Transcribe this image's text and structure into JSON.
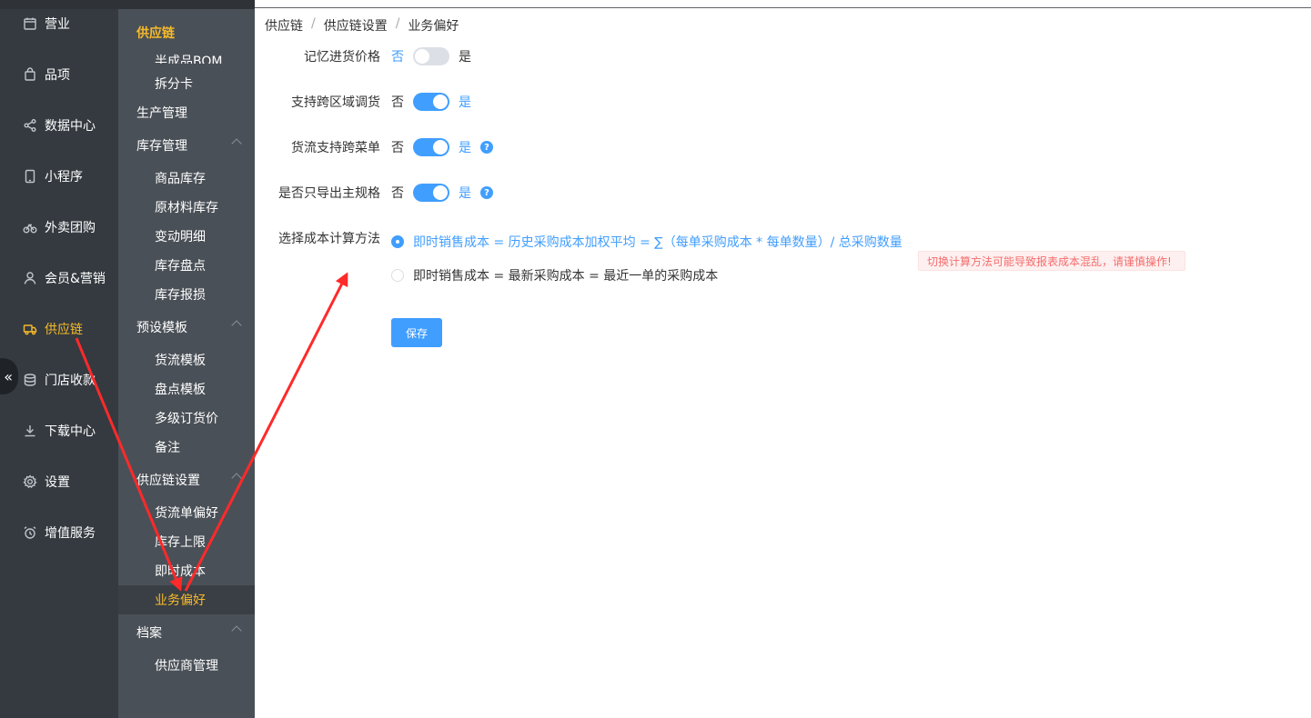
{
  "nav_primary": [
    {
      "label": "营业",
      "icon": "calendar-icon"
    },
    {
      "label": "品项",
      "icon": "shopping-bag-icon"
    },
    {
      "label": "数据中心",
      "icon": "share-icon"
    },
    {
      "label": "小程序",
      "icon": "tablet-icon"
    },
    {
      "label": "外卖团购",
      "icon": "bicycle-icon"
    },
    {
      "label": "会员&营销",
      "icon": "user-icon"
    },
    {
      "label": "供应链",
      "icon": "truck-icon",
      "active": true
    },
    {
      "label": "门店收款",
      "icon": "coins-icon"
    },
    {
      "label": "下载中心",
      "icon": "download-icon"
    },
    {
      "label": "设置",
      "icon": "gear-icon"
    },
    {
      "label": "增值服务",
      "icon": "alarm-clock-icon"
    }
  ],
  "nav_secondary": {
    "title": "供应链",
    "clipped_item": "半成品BOM",
    "items": [
      {
        "type": "sub",
        "label": "拆分卡"
      },
      {
        "type": "group",
        "label": "生产管理"
      },
      {
        "type": "group",
        "label": "库存管理",
        "expanded": true
      },
      {
        "type": "sub",
        "label": "商品库存"
      },
      {
        "type": "sub",
        "label": "原材料库存"
      },
      {
        "type": "sub",
        "label": "变动明细"
      },
      {
        "type": "sub",
        "label": "库存盘点"
      },
      {
        "type": "sub",
        "label": "库存报损"
      },
      {
        "type": "group",
        "label": "预设模板",
        "expanded": true
      },
      {
        "type": "sub",
        "label": "货流模板"
      },
      {
        "type": "sub",
        "label": "盘点模板"
      },
      {
        "type": "sub",
        "label": "多级订货价"
      },
      {
        "type": "sub",
        "label": "备注"
      },
      {
        "type": "group",
        "label": "供应链设置",
        "expanded": true
      },
      {
        "type": "sub",
        "label": "货流单偏好"
      },
      {
        "type": "sub",
        "label": "库存上限"
      },
      {
        "type": "sub",
        "label": "即时成本"
      },
      {
        "type": "sub",
        "label": "业务偏好",
        "active": true
      },
      {
        "type": "group",
        "label": "档案",
        "expanded": true
      },
      {
        "type": "sub",
        "label": "供应商管理"
      }
    ]
  },
  "breadcrumb": [
    "供应链",
    "供应链设置",
    "业务偏好"
  ],
  "form": {
    "remember_price": {
      "label": "记忆进货价格",
      "off": "否",
      "on": "是",
      "value": false
    },
    "cross_region": {
      "label": "支持跨区域调货",
      "off": "否",
      "on": "是",
      "value": true
    },
    "cross_menu": {
      "label": "货流支持跨菜单",
      "off": "否",
      "on": "是",
      "value": true
    },
    "export_main_spec": {
      "label": "是否只导出主规格",
      "off": "否",
      "on": "是",
      "value": true
    },
    "cost_method": {
      "label": "选择成本计算方法",
      "options": [
        "即时销售成本 = 历史采购成本加权平均 = ∑（每单采购成本 * 每单数量）/ 总采购数量",
        "即时销售成本 = 最新采购成本 = 最近一单的采购成本"
      ],
      "selected": 0,
      "warning": "切换计算方法可能导致报表成本混乱，请谨慎操作!"
    },
    "help_icon_text": "?",
    "save_label": "保存"
  },
  "collapse_glyph": "«",
  "colors": {
    "accent": "#409eff",
    "active_nav": "#f7ba2a",
    "annotation": "#ff2a2a"
  }
}
